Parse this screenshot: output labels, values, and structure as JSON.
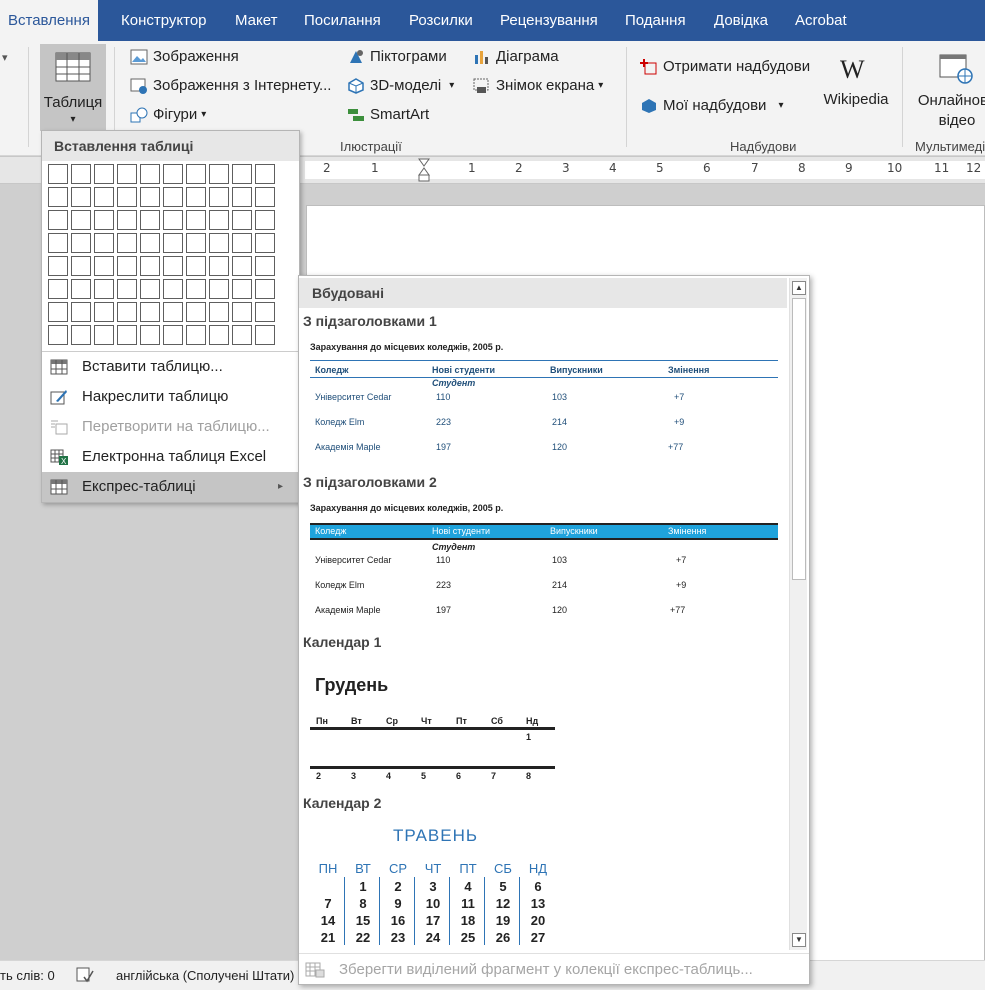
{
  "tabs": [
    "Вставлення",
    "Конструктор",
    "Макет",
    "Посилання",
    "Розсилки",
    "Рецензування",
    "Подання",
    "Довідка",
    "Acrobat"
  ],
  "ribbon": {
    "table_button": "Таблиця",
    "pictures": "Зображення",
    "online_pictures": "Зображення з Інтернету...",
    "shapes": "Фігури",
    "icons": "Піктограми",
    "models_3d": "3D-моделі",
    "smartart": "SmartArt",
    "chart": "Діаграма",
    "screenshot": "Знімок екрана",
    "illustrations_group": "Ілюстрації",
    "get_addins": "Отримати надбудови",
    "my_addins": "Мої надбудови",
    "wikipedia": "Wikipedia",
    "addins_group": "Надбудови",
    "online_video": "Онлайнове відео",
    "media_group": "Мультимедіа"
  },
  "ruler_ticks": [
    "2",
    "1",
    "1",
    "2",
    "3",
    "4",
    "5",
    "6",
    "7",
    "8",
    "9",
    "10",
    "11",
    "12"
  ],
  "table_menu": {
    "header": "Вставлення таблиці",
    "items": [
      {
        "label": "Вставити таблицю...",
        "icon": "table-icon",
        "disabled": false
      },
      {
        "label": "Накреслити таблицю",
        "icon": "pencil-table-icon",
        "disabled": false
      },
      {
        "label": "Перетворити на таблицю...",
        "icon": "convert-table-icon",
        "disabled": true
      },
      {
        "label": "Електронна таблиця Excel",
        "icon": "excel-icon",
        "disabled": false
      },
      {
        "label": "Експрес-таблиці",
        "icon": "quick-table-icon",
        "disabled": false
      }
    ]
  },
  "quick_tables": {
    "header": "Вбудовані",
    "sub1": {
      "title": "З підзаголовками 1",
      "caption": "Зарахування до місцевих коледжів, 2005 р.",
      "cols": [
        "Коледж",
        "Нові студенти",
        "Випускники",
        "Змінення"
      ],
      "subhead": "Студент",
      "rows": [
        [
          "Університет Cedar",
          "110",
          "103",
          "+7"
        ],
        [
          "Коледж Elm",
          "223",
          "214",
          "+9"
        ],
        [
          "Академія Maple",
          "197",
          "120",
          "+77"
        ]
      ]
    },
    "sub2": {
      "title": "З підзаголовками 2",
      "caption": "Зарахування до місцевих коледжів, 2005 р.",
      "cols": [
        "Коледж",
        "Нові студенти",
        "Випускники",
        "Змінення"
      ],
      "subhead": "Студент",
      "rows": [
        [
          "Університет Cedar",
          "110",
          "103",
          "+7"
        ],
        [
          "Коледж Elm",
          "223",
          "214",
          "+9"
        ],
        [
          "Академія Maple",
          "197",
          "120",
          "+77"
        ]
      ]
    },
    "cal1": {
      "title": "Календар 1",
      "month": "Грудень",
      "days": [
        "Пн",
        "Вт",
        "Ср",
        "Чт",
        "Пт",
        "Сб",
        "Нд"
      ],
      "week1": [
        "",
        "",
        "",
        "",
        "",
        "",
        "1"
      ],
      "week2": [
        "2",
        "3",
        "4",
        "5",
        "6",
        "7",
        "8"
      ]
    },
    "cal2": {
      "title": "Календар 2",
      "month": "ТРАВЕНЬ",
      "days": [
        "ПН",
        "ВТ",
        "СР",
        "ЧТ",
        "ПТ",
        "СБ",
        "НД"
      ],
      "weeks": [
        [
          "",
          "1",
          "2",
          "3",
          "4",
          "5",
          "6"
        ],
        [
          "7",
          "8",
          "9",
          "10",
          "11",
          "12",
          "13"
        ],
        [
          "14",
          "15",
          "16",
          "17",
          "18",
          "19",
          "20"
        ],
        [
          "21",
          "22",
          "23",
          "24",
          "25",
          "26",
          "27"
        ]
      ]
    },
    "footer": "Зберегти виділений фрагмент у колекції експрес-таблиць..."
  },
  "status": {
    "words": "ть слів: 0",
    "language": "англійська (Сполучені Штати)"
  },
  "colors": {
    "accent": "#2b579a",
    "table_header_blue": "#1fa3dc",
    "calendar_blue": "#2e74b5"
  }
}
